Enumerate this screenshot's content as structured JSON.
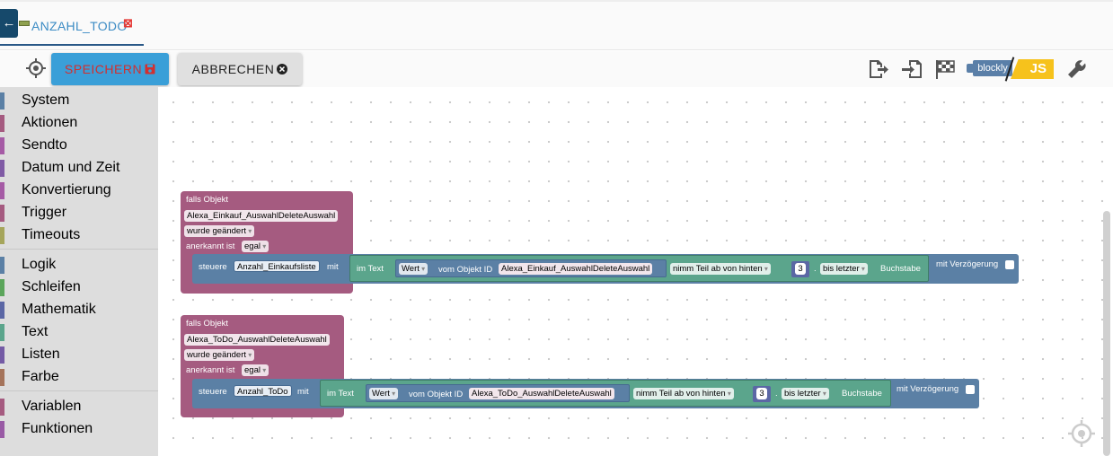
{
  "tab": {
    "label": "ANZAHL_TODO"
  },
  "toolbar": {
    "save_label": "SPEICHERN",
    "cancel_label": "ABBRECHEN",
    "blockly_label": "blockly",
    "js_label": "JS"
  },
  "sidebar": {
    "groups": [
      [
        {
          "label": "System",
          "color": "#5b80a5"
        },
        {
          "label": "Aktionen",
          "color": "#a55b80"
        },
        {
          "label": "Sendto",
          "color": "#a55ba5"
        },
        {
          "label": "Datum und Zeit",
          "color": "#805ba5"
        },
        {
          "label": "Konvertierung",
          "color": "#a55ba5"
        },
        {
          "label": "Trigger",
          "color": "#a55b80"
        },
        {
          "label": "Timeouts",
          "color": "#a5a55b"
        }
      ],
      [
        {
          "label": "Logik",
          "color": "#5b80a5"
        },
        {
          "label": "Schleifen",
          "color": "#5ba55b"
        },
        {
          "label": "Mathematik",
          "color": "#5b67a5"
        },
        {
          "label": "Text",
          "color": "#5ba58c"
        },
        {
          "label": "Listen",
          "color": "#745ba5"
        },
        {
          "label": "Farbe",
          "color": "#a5745b"
        }
      ],
      [
        {
          "label": "Variablen",
          "color": "#a55b80"
        },
        {
          "label": "Funktionen",
          "color": "#995ba5"
        }
      ]
    ]
  },
  "blocks": [
    {
      "falls_objekt": "falls Objekt",
      "object_id": "Alexa_Einkauf_AuswahlDeleteAuswahl",
      "changed": "wurde geändert",
      "acknowledged_label": "anerkannt ist",
      "acknowledged_value": "egal",
      "set_label": "steuere",
      "variable": "Anzahl_Einkaufsliste",
      "with_label": "mit",
      "in_text": "im Text",
      "wert": "Wert",
      "of_object": "vom Objekt ID",
      "object_id_inner": "Alexa_Einkauf_AuswahlDeleteAuswahl",
      "take_part": "nimm Teil ab von hinten",
      "number": "3",
      "dot": ".",
      "to_last": "bis letzter",
      "letter": "Buchstabe",
      "delay": "mit Verzögerung"
    },
    {
      "falls_objekt": "falls Objekt",
      "object_id": "Alexa_ToDo_AuswahlDeleteAuswahl",
      "changed": "wurde geändert",
      "acknowledged_label": "anerkannt ist",
      "acknowledged_value": "egal",
      "set_label": "steuere",
      "variable": "Anzahl_ToDo",
      "with_label": "mit",
      "in_text": "im Text",
      "wert": "Wert",
      "of_object": "vom Objekt ID",
      "object_id_inner": "Alexa_ToDo_AuswahlDeleteAuswahl",
      "take_part": "nimm Teil ab von hinten",
      "number": "3",
      "dot": ".",
      "to_last": "bis letzter",
      "letter": "Buchstabe",
      "delay": "mit Verzögerung"
    }
  ]
}
